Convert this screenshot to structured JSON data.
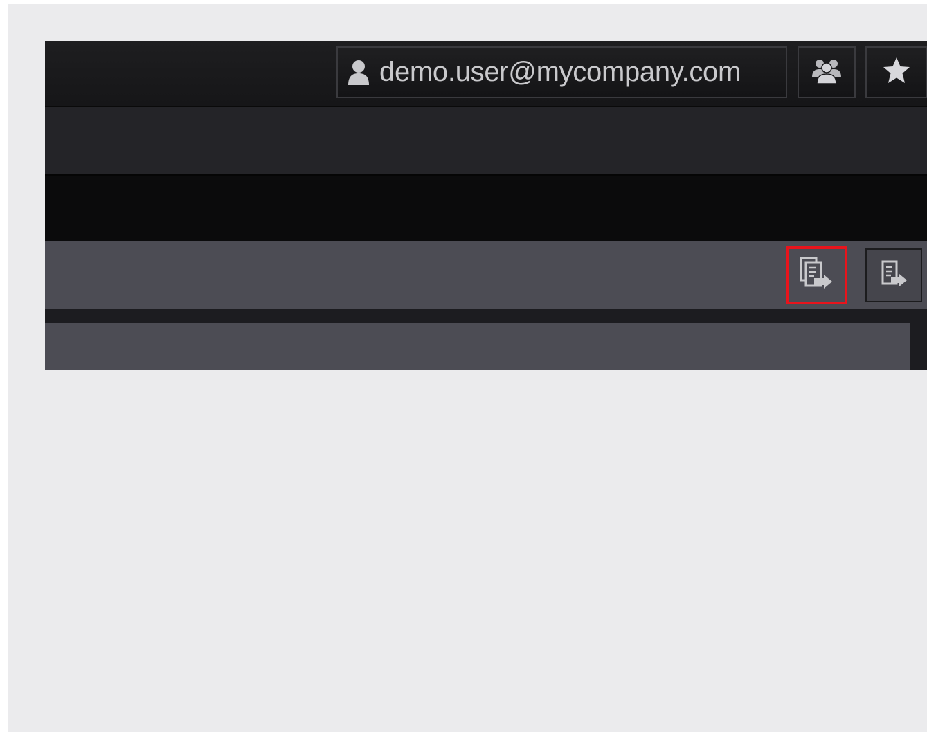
{
  "header": {
    "user_email": "demo.user@mycompany.com",
    "user_icon": "user-icon",
    "groups_icon": "users-icon",
    "favorites_icon": "star-icon"
  },
  "toolbar": {
    "export_all_icon": "export-multiple-documents-icon",
    "export_icon": "export-document-icon",
    "highlight_color": "#e8141c"
  },
  "colors": {
    "background": "#ebebed",
    "topbar": "#1a1a1c",
    "toolbar": "#4c4c54",
    "icon": "#c9c9cc"
  }
}
